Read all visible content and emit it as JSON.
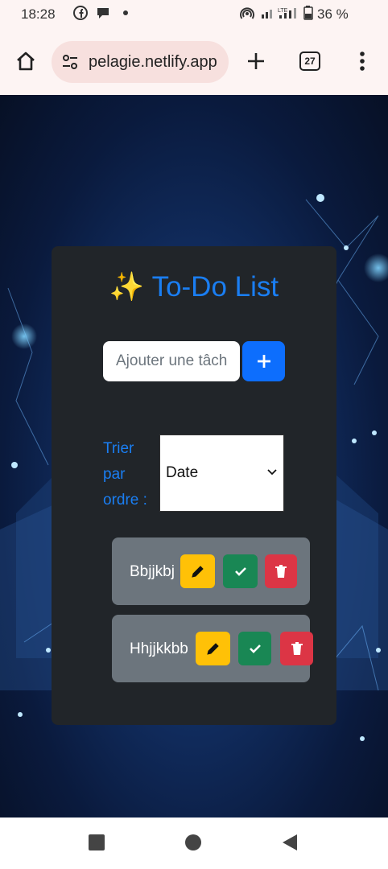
{
  "status_bar": {
    "time": "18:28",
    "battery": "36 %",
    "icons": [
      "facebook-icon",
      "chat-icon",
      "dot-icon",
      "hotspot-icon",
      "signal-icon",
      "lte-signal-icon",
      "battery-icon"
    ]
  },
  "browser": {
    "url": "pelagie.netlify.app",
    "tab_count": "27",
    "icons": [
      "home-icon",
      "site-settings-icon",
      "new-tab-plus-icon",
      "tab-switcher-icon",
      "menu-dots-icon"
    ]
  },
  "app": {
    "title_emoji": "✨",
    "title_text": "To-Do List",
    "input_placeholder": "Ajouter une tâche",
    "add_icon": "plus-icon",
    "sort_label": "Trier par ordre :",
    "sort_selected": "Date"
  },
  "tasks": [
    {
      "name": "Bbjjkbj"
    },
    {
      "name": "Hhjjkkbb"
    }
  ],
  "colors": {
    "accent": "#1a7ef2",
    "card_bg": "#212529",
    "task_bg": "#6c757d",
    "edit": "#ffc107",
    "done": "#198754",
    "delete": "#dc3545"
  },
  "navbar": {
    "icons": [
      "recents-square-icon",
      "home-circle-icon",
      "back-triangle-icon"
    ]
  }
}
